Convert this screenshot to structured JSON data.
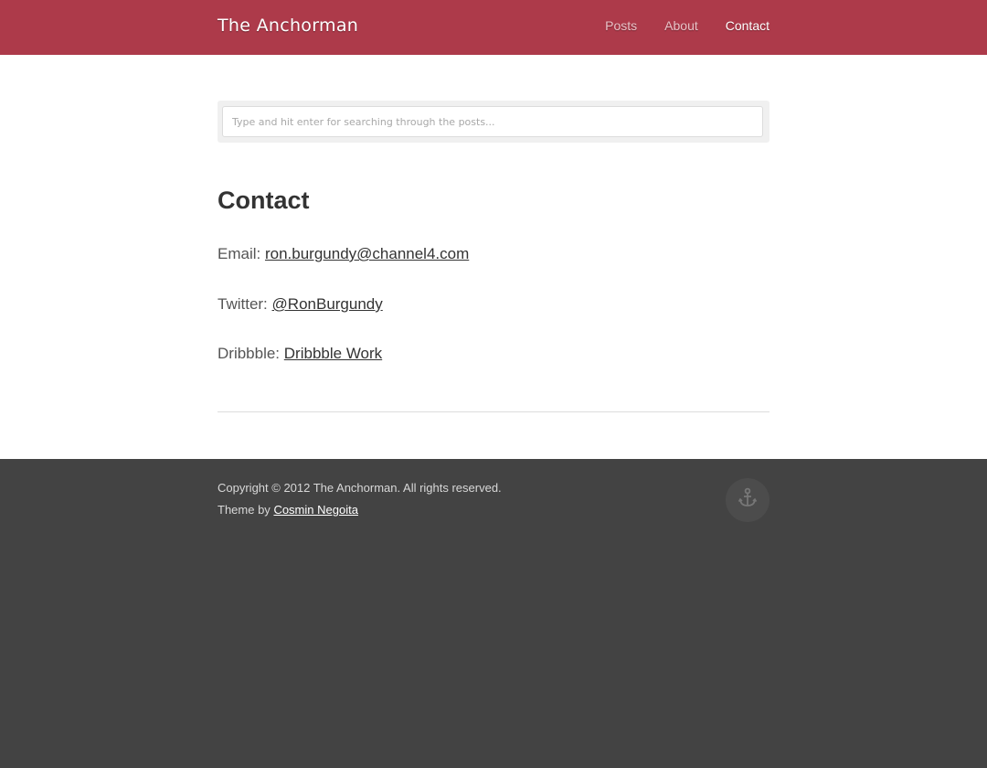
{
  "header": {
    "brand": "The Anchorman",
    "nav": [
      {
        "label": "Posts"
      },
      {
        "label": "About"
      },
      {
        "label": "Contact"
      }
    ],
    "brand_color": "#ad3a4a"
  },
  "search": {
    "placeholder": "Type and hit enter for searching through the posts..."
  },
  "page": {
    "title": "Contact",
    "contacts": [
      {
        "label": "Email:",
        "link": "ron.burgundy@channel4.com"
      },
      {
        "label": "Twitter:",
        "link": "@RonBurgundy"
      },
      {
        "label": "Dribbble:",
        "link": "Dribbble Work"
      }
    ]
  },
  "footer": {
    "copyright": "Copyright © 2012 The Anchorman. All rights reserved.",
    "theme_prefix": "Theme by",
    "theme_author": "Cosmin Negoita",
    "icon": "anchor-icon",
    "background": "#434343"
  }
}
